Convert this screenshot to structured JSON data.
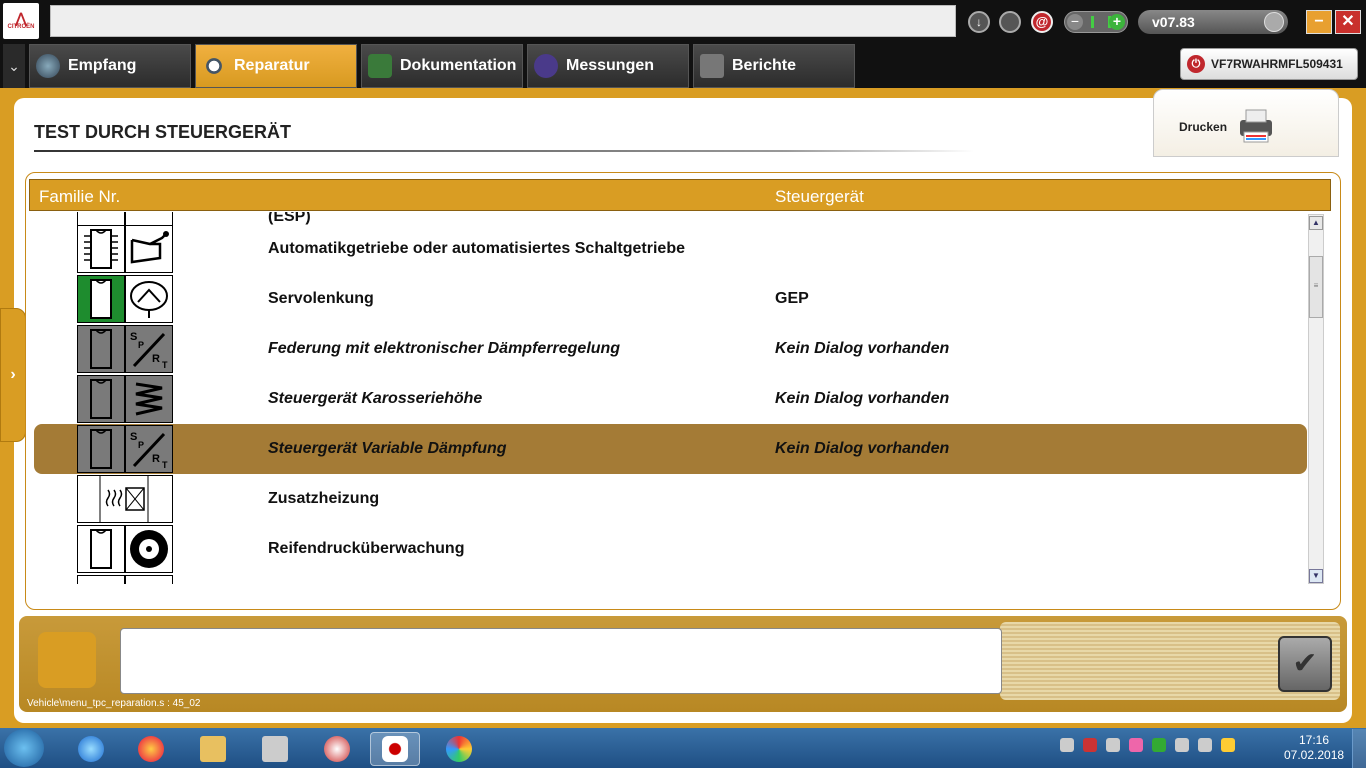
{
  "window": {
    "logo_text": "CITROËN",
    "version": "v07.83",
    "minimize": "−",
    "close": "✕"
  },
  "nav": {
    "menu_glyph": "⌄",
    "tabs": [
      {
        "label": "Empfang",
        "icon": "globe-icon"
      },
      {
        "label": "Reparatur",
        "icon": "magnifier-icon"
      },
      {
        "label": "Dokumentation",
        "icon": "book-icon"
      },
      {
        "label": "Messungen",
        "icon": "waveform-icon"
      },
      {
        "label": "Berichte",
        "icon": "document-icon"
      }
    ],
    "active_tab": "Reparatur",
    "vin": "VF7RWAHRMFL509431"
  },
  "page": {
    "title": "TEST DURCH STEUERGERÄT",
    "print_label": "Drucken",
    "side_handle": "›"
  },
  "grid": {
    "columns": [
      "Familie Nr.",
      "Steuergerät"
    ],
    "rows": [
      {
        "name": "(ESP)",
        "controller": "",
        "icon": "esp-icon",
        "style": "normal"
      },
      {
        "name": "Automatikgetriebe oder automatisiertes Schaltgetriebe",
        "controller": "",
        "icon": "gearbox-icon",
        "style": "normal"
      },
      {
        "name": "Servolenkung",
        "controller": "GEP",
        "icon": "steering-icon",
        "style": "normal"
      },
      {
        "name": "Federung mit elektronischer Dämpferregelung",
        "controller": "Kein Dialog vorhanden",
        "icon": "suspension-icon",
        "style": "italic"
      },
      {
        "name": "Steuergerät Karosseriehöhe",
        "controller": "Kein Dialog vorhanden",
        "icon": "spring-icon",
        "style": "italic"
      },
      {
        "name": "Steuergerät Variable Dämpfung",
        "controller": "Kein Dialog vorhanden",
        "icon": "damper-icon",
        "style": "italic",
        "selected": true
      },
      {
        "name": "Zusatzheizung",
        "controller": "",
        "icon": "heater-icon",
        "style": "normal"
      },
      {
        "name": "Reifendrucküberwachung",
        "controller": "",
        "icon": "tyre-icon",
        "style": "normal"
      }
    ],
    "selected_row": "Steuergerät Variable Dämpfung"
  },
  "bottom": {
    "message": "",
    "ok_glyph": "✔",
    "path": "Vehicle\\menu_tpc_reparation.s : 45_02"
  },
  "taskbar": {
    "time": "17:16",
    "date": "07.02.2018",
    "apps": [
      "internet-explorer-icon",
      "firefox-icon",
      "file-explorer-icon",
      "calculator-icon",
      "diagnostic-tool-icon",
      "diagbox-icon",
      "paint-icon"
    ]
  },
  "colors": {
    "accent": "#d99d23",
    "selected_row": "#a47b36",
    "green_icon": "#1e8c2e"
  }
}
